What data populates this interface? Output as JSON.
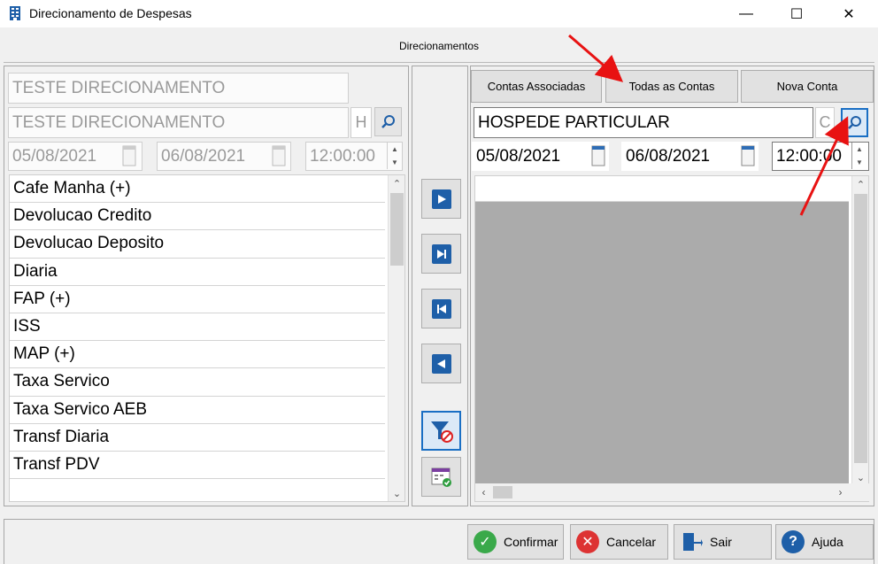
{
  "window": {
    "title": "Direcionamento de Despesas",
    "min_glyph": "—",
    "max_glyph": "☐",
    "close_glyph": "✕"
  },
  "header": {
    "title": "Direcionamentos"
  },
  "left": {
    "name_field": "TESTE DIRECIONAMENTO",
    "account_field": "TESTE DIRECIONAMENTO",
    "type_code": "H",
    "date_from": "05/08/2021",
    "date_to": "06/08/2021",
    "time": "12:00:00",
    "items": [
      "Cafe Manha (+)",
      "Devolucao Credito",
      "Devolucao Deposito",
      "Diaria",
      "FAP (+)",
      "ISS",
      "MAP (+)",
      "Taxa Servico",
      "Taxa Servico AEB",
      "Transf Diaria",
      "Transf PDV"
    ]
  },
  "right": {
    "tabs": [
      "Contas Associadas",
      "Todas as Contas",
      "Nova Conta"
    ],
    "account_field": "HOSPEDE PARTICULAR",
    "type_code": "C",
    "date_from": "05/08/2021",
    "date_to": "06/08/2021",
    "time": "12:00:00"
  },
  "footer": {
    "confirm_label": "Confirmar",
    "cancel_label": "Cancelar",
    "exit_label": "Sair",
    "help_label": "Ajuda"
  },
  "colors": {
    "accent": "#1a6fc4",
    "annotation_arrow": "#e81212",
    "grid_empty": "#ababab"
  }
}
